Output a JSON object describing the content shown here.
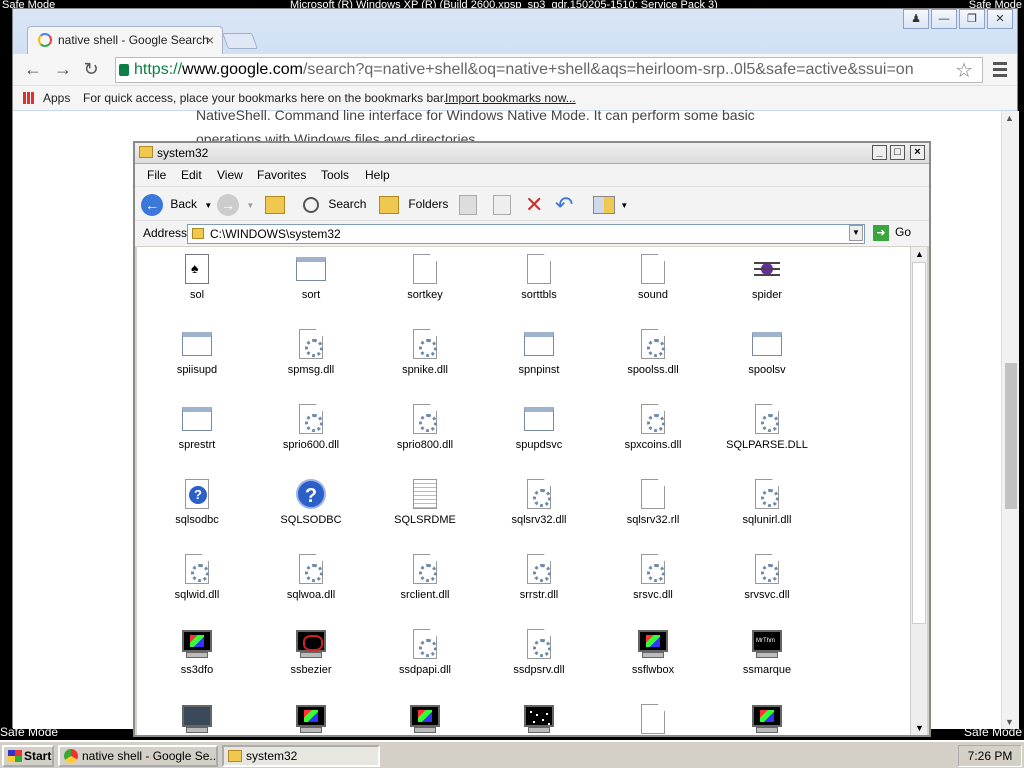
{
  "desktop": {
    "safe_mode_label": "Safe Mode",
    "build_text": "Microsoft (R) Windows XP (R) (Build 2600.xpsp_sp3_gdr.150205-1510: Service Pack 3)"
  },
  "chrome": {
    "tab_title": "native shell - Google Search",
    "url_scheme": "https://",
    "url_domain": "www.google.com",
    "url_rest": "/search?q=native+shell&oq=native+shell&aqs=heirloom-srp..0l5&safe=active&ssui=on",
    "bookmarks": {
      "apps_label": "Apps",
      "hint": "For quick access, place your bookmarks here on the bookmarks bar.",
      "import_link": "Import bookmarks now..."
    },
    "page_text_line1": "NativeShell. Command line interface for Windows Native Mode. It can perform some basic",
    "page_text_line2": "operations with Windows files and directories."
  },
  "explorer": {
    "title": "system32",
    "menu": [
      "File",
      "Edit",
      "View",
      "Favorites",
      "Tools",
      "Help"
    ],
    "toolbar": {
      "back_label": "Back",
      "search_label": "Search",
      "folders_label": "Folders"
    },
    "address_label": "Address",
    "address_value": "C:\\WINDOWS\\system32",
    "go_label": "Go",
    "files": [
      {
        "name": "sol",
        "icon": "card-icon"
      },
      {
        "name": "sort",
        "icon": "app-icon"
      },
      {
        "name": "sortkey",
        "icon": "doc-icon"
      },
      {
        "name": "sorttbls",
        "icon": "doc-icon"
      },
      {
        "name": "sound",
        "icon": "doc-icon"
      },
      {
        "name": "spider",
        "icon": "spider-icon"
      },
      {
        "name": "spiisupd",
        "icon": "app-icon"
      },
      {
        "name": "spmsg.dll",
        "icon": "dll-icon"
      },
      {
        "name": "spnike.dll",
        "icon": "dll-icon"
      },
      {
        "name": "spnpinst",
        "icon": "app-icon"
      },
      {
        "name": "spoolss.dll",
        "icon": "dll-icon"
      },
      {
        "name": "spoolsv",
        "icon": "app-icon"
      },
      {
        "name": "sprestrt",
        "icon": "app-icon"
      },
      {
        "name": "sprio600.dll",
        "icon": "dll-icon"
      },
      {
        "name": "sprio800.dll",
        "icon": "dll-icon"
      },
      {
        "name": "spupdsvc",
        "icon": "app-icon"
      },
      {
        "name": "spxcoins.dll",
        "icon": "dll-icon"
      },
      {
        "name": "SQLPARSE.DLL",
        "icon": "dll-icon"
      },
      {
        "name": "sqlsodbc",
        "icon": "helpdoc-icon"
      },
      {
        "name": "SQLSODBC",
        "icon": "help-icon"
      },
      {
        "name": "SQLSRDME",
        "icon": "text-icon"
      },
      {
        "name": "sqlsrv32.dll",
        "icon": "dll-icon"
      },
      {
        "name": "sqlsrv32.rll",
        "icon": "doc-icon"
      },
      {
        "name": "sqlunirl.dll",
        "icon": "dll-icon"
      },
      {
        "name": "sqlwid.dll",
        "icon": "dll-icon"
      },
      {
        "name": "sqlwoa.dll",
        "icon": "dll-icon"
      },
      {
        "name": "srclient.dll",
        "icon": "dll-icon"
      },
      {
        "name": "srrstr.dll",
        "icon": "dll-icon"
      },
      {
        "name": "srsvc.dll",
        "icon": "dll-icon"
      },
      {
        "name": "srvsvc.dll",
        "icon": "dll-icon"
      },
      {
        "name": "ss3dfo",
        "icon": "screensaver-color-icon"
      },
      {
        "name": "ssbezier",
        "icon": "screensaver-red-icon"
      },
      {
        "name": "ssdpapi.dll",
        "icon": "dll-icon"
      },
      {
        "name": "ssdpsrv.dll",
        "icon": "dll-icon"
      },
      {
        "name": "ssflwbox",
        "icon": "screensaver-color-icon"
      },
      {
        "name": "ssmarque",
        "icon": "screensaver-text-icon"
      },
      {
        "name": "",
        "icon": "screensaver-gray-icon"
      },
      {
        "name": "",
        "icon": "screensaver-color-icon"
      },
      {
        "name": "",
        "icon": "screensaver-color-icon"
      },
      {
        "name": "",
        "icon": "screensaver-stars-icon"
      },
      {
        "name": "",
        "icon": "doc-icon"
      },
      {
        "name": "",
        "icon": "screensaver-color-icon"
      }
    ]
  },
  "taskbar": {
    "start_label": "Start",
    "task_chrome": "native shell - Google Se...",
    "task_explorer": "system32",
    "clock": "7:26 PM"
  }
}
